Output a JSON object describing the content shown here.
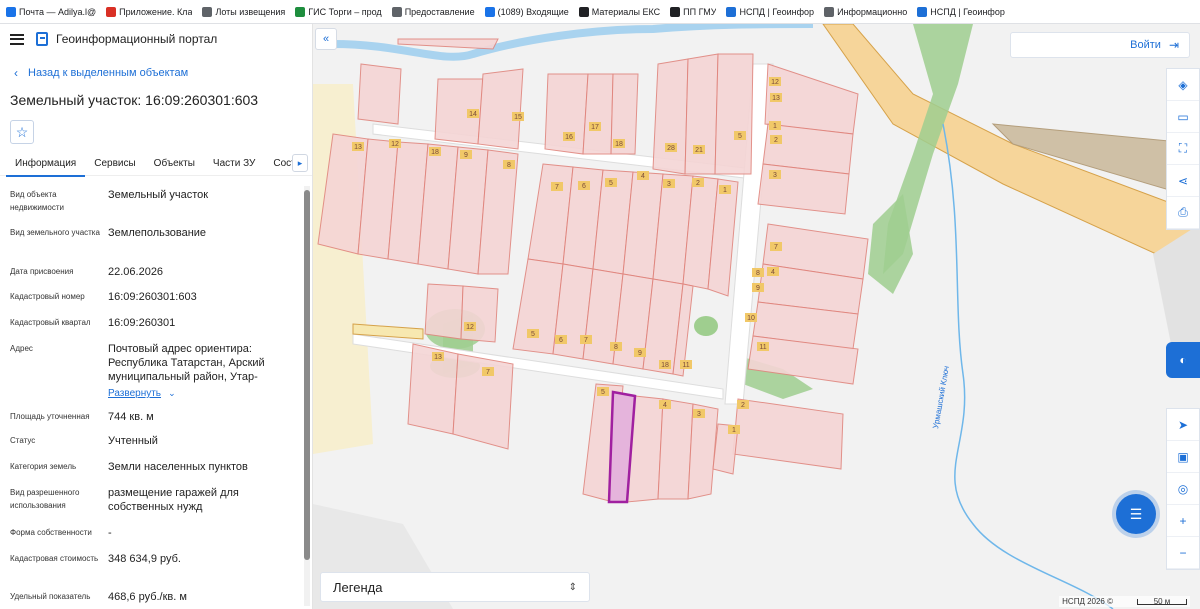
{
  "bookmarks": [
    {
      "label": "Почта — Adilya.l@",
      "color": "#1a73e8"
    },
    {
      "label": "Приложение. Кла",
      "color": "#d93025"
    },
    {
      "label": "Лоты извещения",
      "color": "#5f6368"
    },
    {
      "label": "ГИС Торги – прод",
      "color": "#1e8e3e"
    },
    {
      "label": "Предоставление",
      "color": "#5f6368"
    },
    {
      "label": "(1089) Входящие",
      "color": "#1a73e8"
    },
    {
      "label": "Материалы ЕКС",
      "color": "#202124"
    },
    {
      "label": "ПП ГМУ",
      "color": "#202124"
    },
    {
      "label": "НСПД | Геоинфор",
      "color": "#1d6fd6"
    },
    {
      "label": "Информационно",
      "color": "#5f6368"
    },
    {
      "label": "НСПД | Геоинфор",
      "color": "#1d6fd6"
    }
  ],
  "header": {
    "portal_title": "Геоинформационный портал"
  },
  "back_link": "Назад к выделенным объектам",
  "parcel_title": "Земельный участок: 16:09:260301:603",
  "tabs": [
    "Информация",
    "Сервисы",
    "Объекты",
    "Части ЗУ",
    "Состав"
  ],
  "properties": [
    {
      "label": "Вид объекта недвижимости",
      "value": "Земельный участок"
    },
    {
      "label": "Вид земельного участка",
      "value": "Землепользование"
    },
    {
      "label": "Дата присвоения",
      "value": "22.06.2026"
    },
    {
      "label": "Кадастровый номер",
      "value": "16:09:260301:603"
    },
    {
      "label": "Кадастровый квартал",
      "value": "16:09:260301"
    },
    {
      "label": "Адрес",
      "value": "Почтовый адрес ориентира: Республика Татарстан, Арский муниципальный район, Утар-"
    },
    {
      "label": "Площадь уточненная",
      "value": "744 кв. м"
    },
    {
      "label": "Статус",
      "value": "Учтенный"
    },
    {
      "label": "Категория земель",
      "value": "Земли населенных пунктов"
    },
    {
      "label": "Вид разрешенного использования",
      "value": "размещение гаражей для собственных нужд"
    },
    {
      "label": "Форма собственности",
      "value": "-"
    },
    {
      "label": "Кадастровая стоимость",
      "value": "348 634,9 руб."
    },
    {
      "label": "Удельный показатель",
      "value": "468,6 руб./кв. м"
    }
  ],
  "expand_label": "Развернуть",
  "map": {
    "login_label": "Войти",
    "legend_label": "Легенда",
    "attribution": "НСПД 2026 ©",
    "scale_label": "50 м",
    "river_label": "Урмашский Ключ",
    "parcel_numbers": [
      "14",
      "15",
      "16",
      "17",
      "18",
      "28",
      "21",
      "5",
      "13",
      "12",
      "18",
      "9",
      "8",
      "7",
      "6",
      "5",
      "4",
      "3",
      "2",
      "1",
      "7",
      "8",
      "9",
      "10",
      "11",
      "12",
      "13",
      "7",
      "5",
      "4",
      "3",
      "2",
      "1",
      "12",
      "13",
      "1",
      "2",
      "3",
      "4",
      "5",
      "6",
      "7",
      "8",
      "9",
      "18",
      "11"
    ],
    "colors": {
      "parcel_fill": "#f5d5d5",
      "parcel_stroke": "#e0867e",
      "road": "#f7e3a0",
      "road_stroke": "#d6a24a",
      "water": "#a9d3ef",
      "green": "#9fce8f",
      "selected": "#a020a0"
    }
  }
}
